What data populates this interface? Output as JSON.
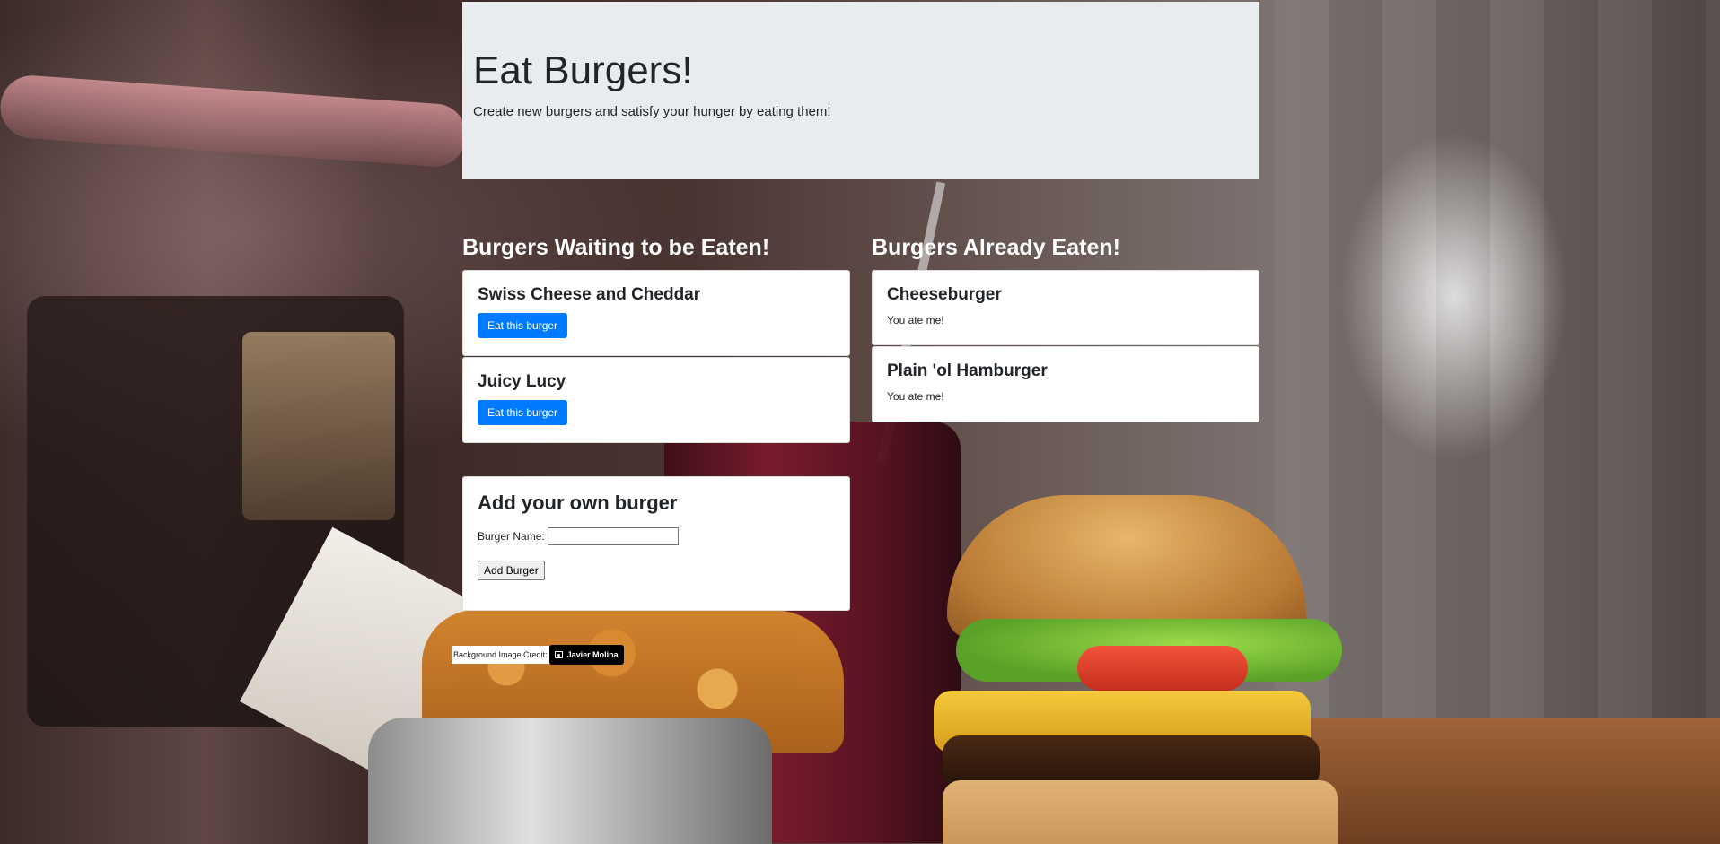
{
  "jumbotron": {
    "title": "Eat Burgers!",
    "subtitle": "Create new burgers and satisfy your hunger by eating them!"
  },
  "waiting": {
    "heading": "Burgers Waiting to be Eaten!",
    "button_label": "Eat this burger",
    "items": [
      {
        "name": "Swiss Cheese and Cheddar"
      },
      {
        "name": "Juicy Lucy"
      }
    ]
  },
  "eaten": {
    "heading": "Burgers Already Eaten!",
    "note": "You ate me!",
    "items": [
      {
        "name": "Cheeseburger"
      },
      {
        "name": "Plain 'ol Hamburger"
      }
    ]
  },
  "add_form": {
    "heading": "Add your own burger",
    "label": "Burger Name:",
    "input_value": "",
    "button_label": "Add Burger"
  },
  "credit": {
    "text": "Background Image Credit:",
    "author": "Javier Molina",
    "icon": "camera-icon"
  },
  "colors": {
    "primary": "#007bff",
    "jumbotron_bg": "#e9ecef",
    "heading_text": "#ffffff"
  }
}
